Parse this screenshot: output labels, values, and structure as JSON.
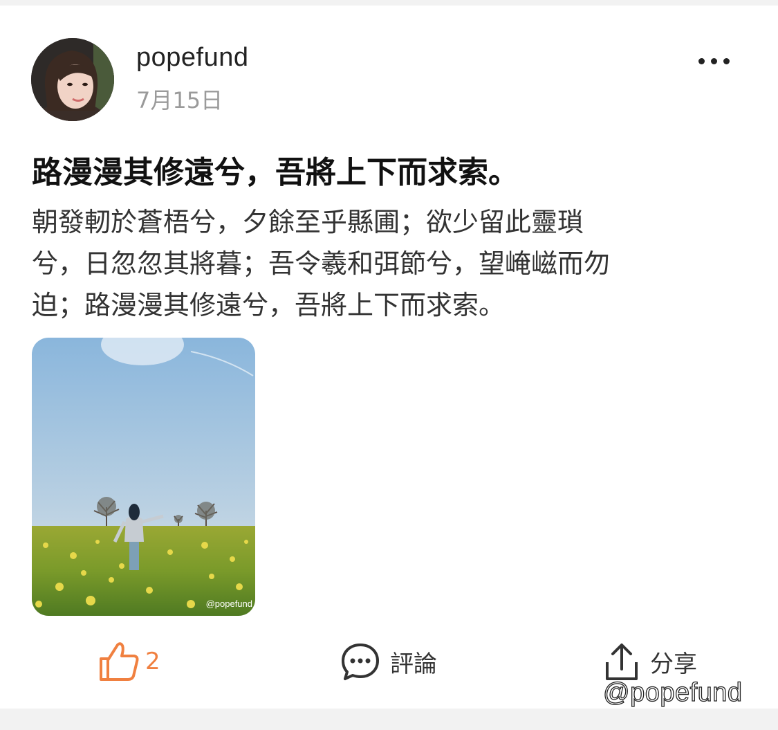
{
  "post": {
    "username": "popefund",
    "date": "7月15日",
    "title": "路漫漫其修遠兮，吾將上下而求索。",
    "body_lines": [
      "朝發軔於蒼梧兮，夕餘至乎縣圃；欲少留此靈瑣",
      "兮，日忽忽其將暮；吾令羲和弭節兮，望崦嵫而勿",
      "迫；路漫漫其修遠兮，吾將上下而求索。"
    ],
    "image_watermark": "@popefund"
  },
  "actions": {
    "like_count": "2",
    "comment_label": "評論",
    "share_label": "分享"
  },
  "watermark": "@popefund",
  "colors": {
    "like_accent": "#f08040",
    "text_primary": "#111111",
    "text_secondary": "#9a9a9a"
  },
  "icons": {
    "more": "more-dots-icon",
    "like": "thumbs-up-icon",
    "comment": "comment-bubble-icon",
    "share": "share-upload-icon"
  }
}
